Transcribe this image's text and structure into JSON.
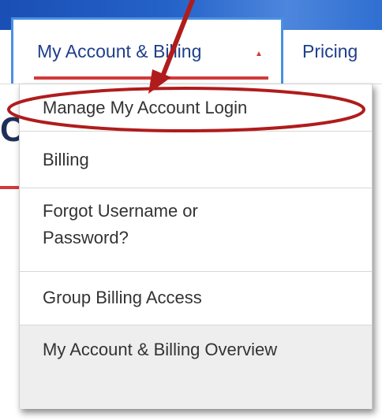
{
  "nav": {
    "active_tab_label": "My Account & Billing",
    "caret_icon": "caret-up-icon",
    "other_tab_label": "Pricing"
  },
  "background": {
    "partial_letter": "C"
  },
  "menu": {
    "items": [
      {
        "label": "Manage My Account Login"
      },
      {
        "label": "Billing"
      },
      {
        "label": "Forgot Username or Password?"
      },
      {
        "label": "Group Billing Access"
      },
      {
        "label": "My Account & Billing Overview"
      }
    ]
  },
  "annotation": {
    "color": "#b01c1c",
    "shapes": [
      "ellipse-around-first-item",
      "arrow-pointing-to-first-item"
    ]
  },
  "colors": {
    "nav_text": "#1f3f8a",
    "accent_red": "#d23a3a",
    "active_tab_border": "#4a90e2",
    "banner": "#2563c9"
  }
}
